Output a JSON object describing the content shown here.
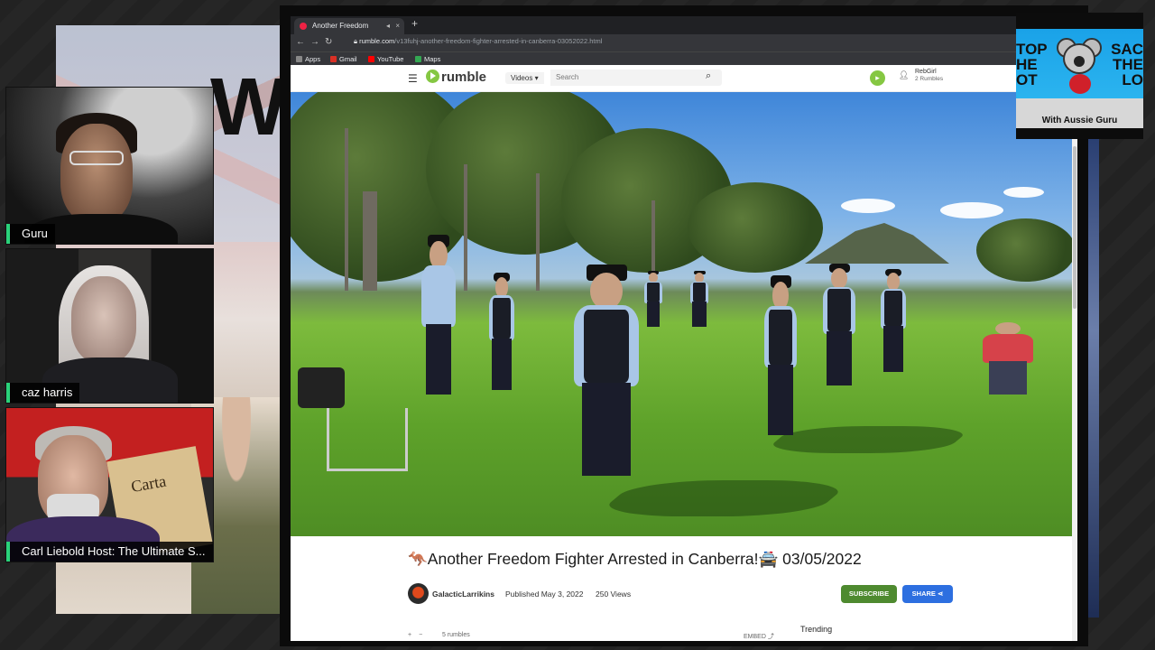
{
  "participants": [
    {
      "name": "Guru"
    },
    {
      "name": "caz harris"
    },
    {
      "name": "Carl Liebold Host: The Ultimate S..."
    }
  ],
  "poster": {
    "letter": "W",
    "document_text": "Carta"
  },
  "browser": {
    "tab_title": "Another Freedom",
    "url_host": "rumble.com",
    "url_path": "/v13fuhj-another-freedom-fighter-arrested-in-canberra-03052022.html",
    "bookmarks": [
      "Apps",
      "Gmail",
      "YouTube",
      "Maps"
    ]
  },
  "rumble": {
    "logo_text": "rumble",
    "category_select": "Videos",
    "search_placeholder": "Search",
    "user_name": "RebGirl",
    "user_rumbles": "2 Rumbles"
  },
  "video": {
    "title": "🦘Another Freedom Fighter Arrested in Canberra!🚔 03/05/2022",
    "channel": "GalacticLarrikins",
    "published": "Published May 3, 2022",
    "views": "250 Views",
    "subscribe_label": "SUBSCRIBE",
    "share_label": "SHARE",
    "rumbles": "5 rumbles",
    "embed_label": "EMBED",
    "trending_label": "Trending"
  },
  "brand": {
    "left_text": "TOP\nHE\nOT",
    "right_text": "SAC\nTHE\nLO",
    "tagline": "With Aussie Guru"
  },
  "colors": {
    "rumble_green": "#85c742",
    "subscribe_green": "#4e8a2f",
    "share_blue": "#2d6fe0",
    "speaker_accent": "#2ad27a"
  }
}
